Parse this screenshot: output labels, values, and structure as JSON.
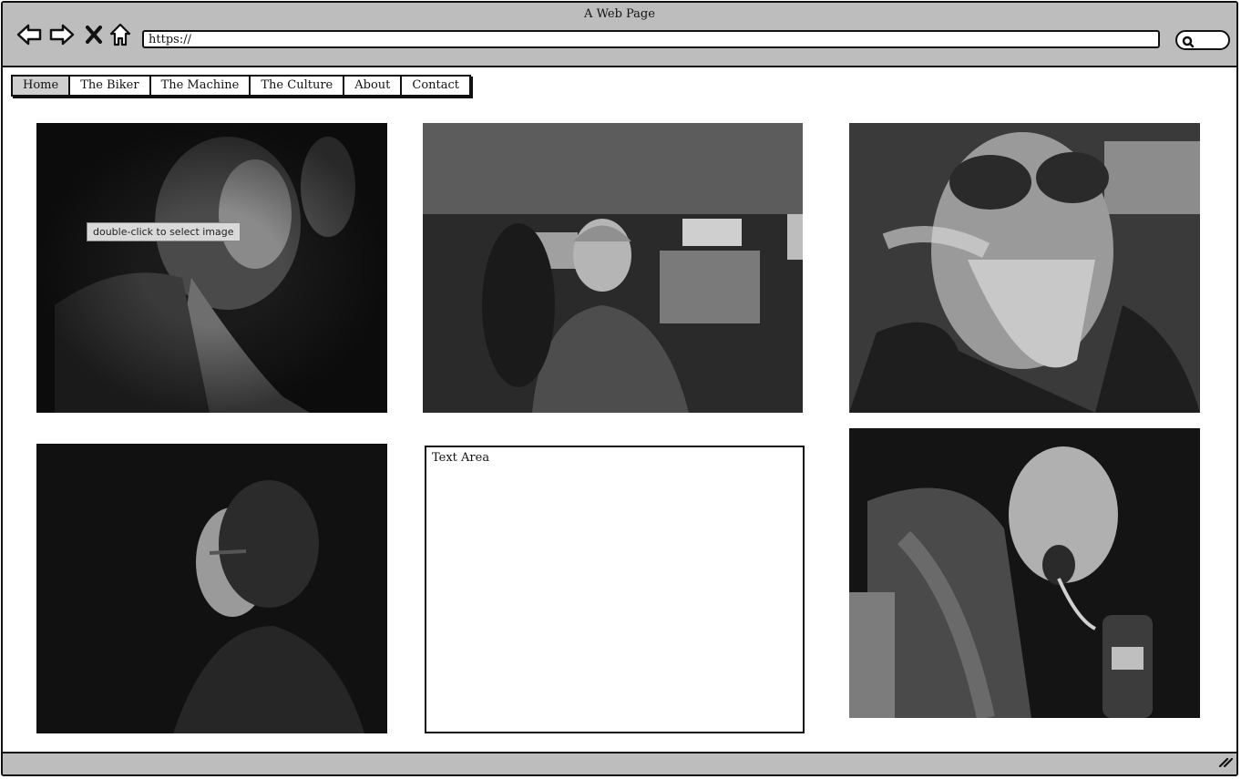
{
  "window": {
    "title": "A Web Page"
  },
  "toolbar": {
    "back_icon": "back-arrow-icon",
    "forward_icon": "forward-arrow-icon",
    "stop_icon": "close-icon",
    "home_icon": "home-icon",
    "url": "https://",
    "search_icon": "search-icon"
  },
  "menu": {
    "items": [
      {
        "label": "Home",
        "active": true
      },
      {
        "label": "The Biker"
      },
      {
        "label": "The Machine"
      },
      {
        "label": "The Culture"
      },
      {
        "label": "About"
      },
      {
        "label": "Contact"
      }
    ]
  },
  "gallery": {
    "tooltip": "double-click to select image",
    "text_area_label": "Text Area"
  },
  "colors": {
    "chrome": "#bdbdbd",
    "border": "#111111",
    "active_tab": "#cfcfcf"
  }
}
